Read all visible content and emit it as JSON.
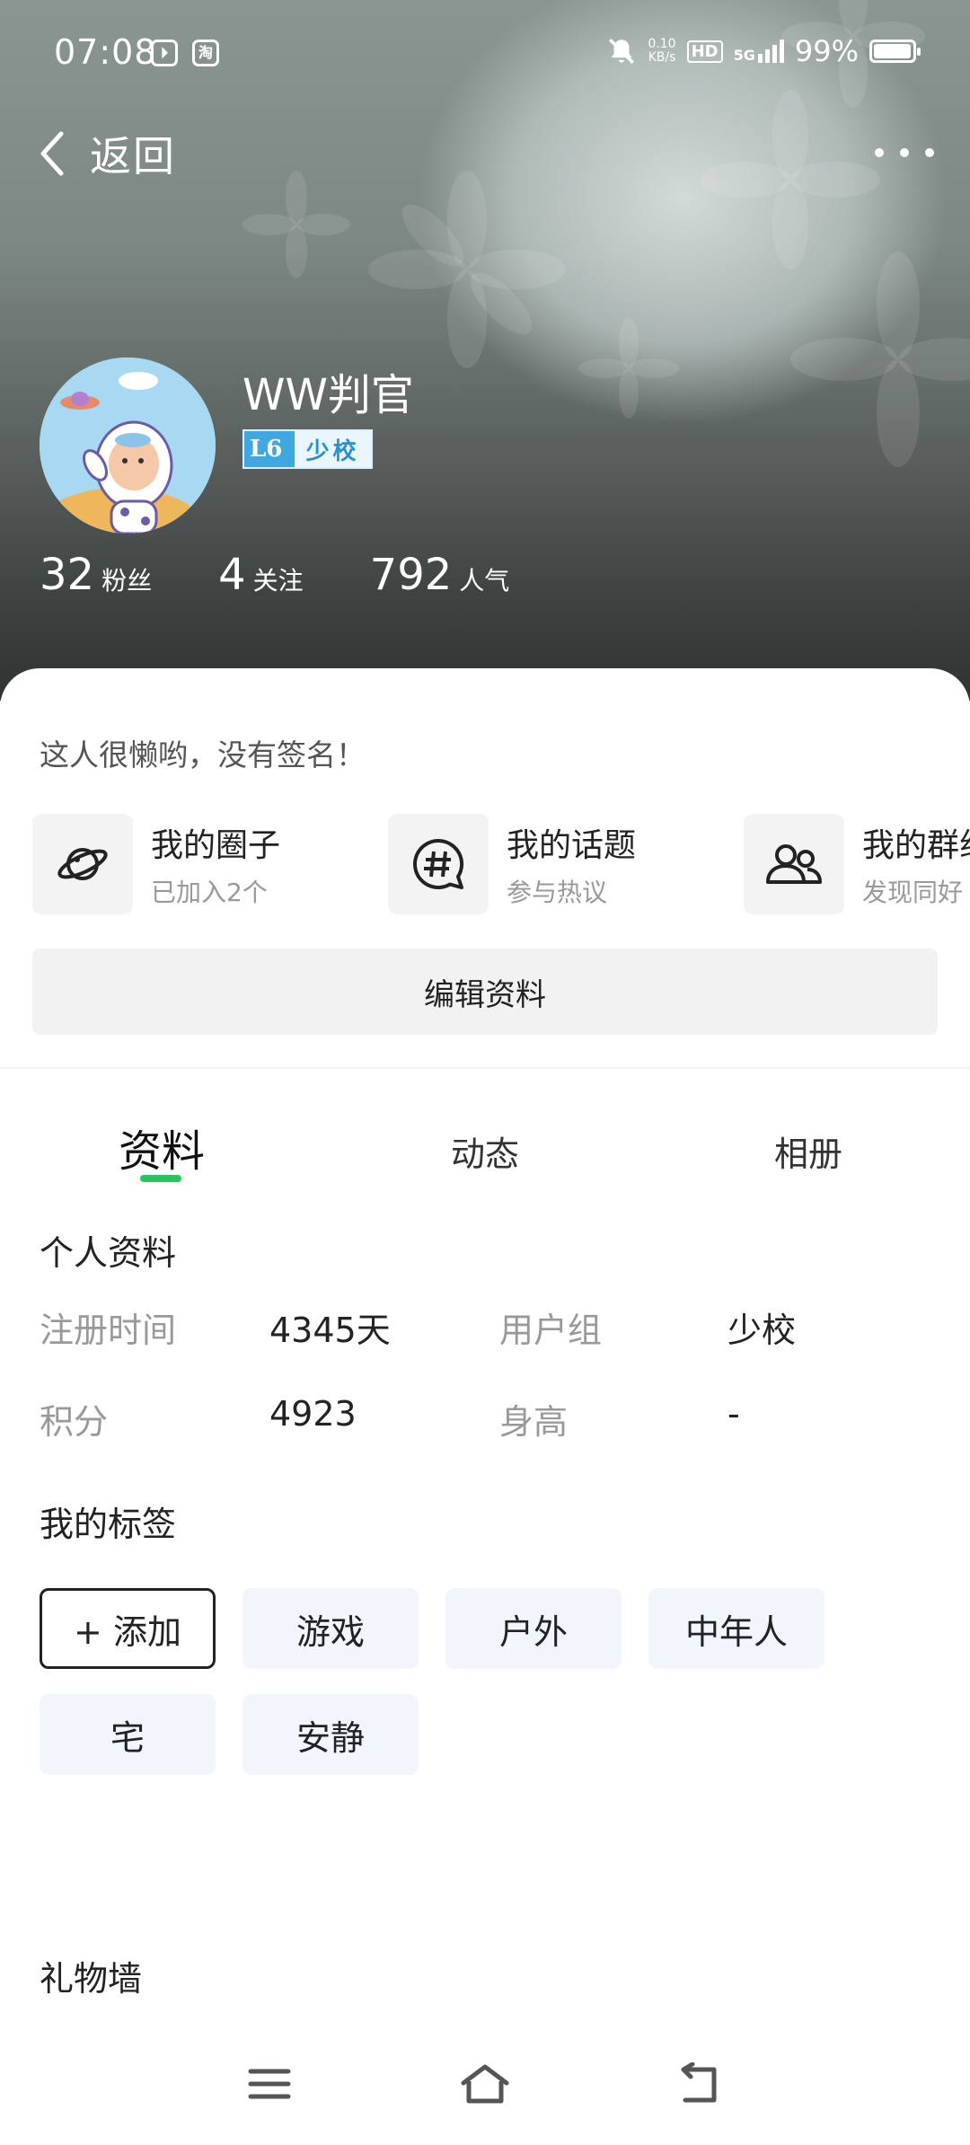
{
  "status_bar": {
    "time": "07:08",
    "app_icon_1": "⏵",
    "app_icon_2": "淘",
    "net_speed_value": "0.10",
    "net_speed_unit": "KB/s",
    "hd_label": "HD",
    "signal_label": "5G",
    "battery": "99%"
  },
  "nav": {
    "back_label": "返回"
  },
  "profile": {
    "username": "WW判官",
    "level": "L6",
    "rank": "少校",
    "stats": [
      {
        "value": "32",
        "label": "粉丝"
      },
      {
        "value": "4",
        "label": "关注"
      },
      {
        "value": "792",
        "label": "人气"
      }
    ]
  },
  "card": {
    "signature": "这人很懒哟，没有签名！",
    "shortcuts": [
      {
        "title": "我的圈子",
        "subtitle": "已加入2个",
        "icon": "planet-icon"
      },
      {
        "title": "我的话题",
        "subtitle": "参与热议",
        "icon": "hashtag-chat-icon"
      },
      {
        "title": "我的群组",
        "subtitle": "发现同好",
        "icon": "group-icon"
      }
    ],
    "edit_button": "编辑资料"
  },
  "tabs": [
    "资料",
    "动态",
    "相册"
  ],
  "info": {
    "section_title": "个人资料",
    "rows": [
      {
        "label1": "注册时间",
        "value1": "4345天",
        "label2": "用户组",
        "value2": "少校"
      },
      {
        "label1": "积分",
        "value1": "4923",
        "label2": "身高",
        "value2": "-"
      }
    ]
  },
  "tags": {
    "section_title": "我的标签",
    "add_label": "+ 添加",
    "items": [
      "游戏",
      "户外",
      "中年人",
      "宅",
      "安静"
    ]
  },
  "gifts": {
    "section_title": "礼物墙"
  },
  "colors": {
    "accent_green": "#27c45f",
    "badge_blue": "#3ea9e0",
    "tag_bg": "#f1f6fd"
  }
}
